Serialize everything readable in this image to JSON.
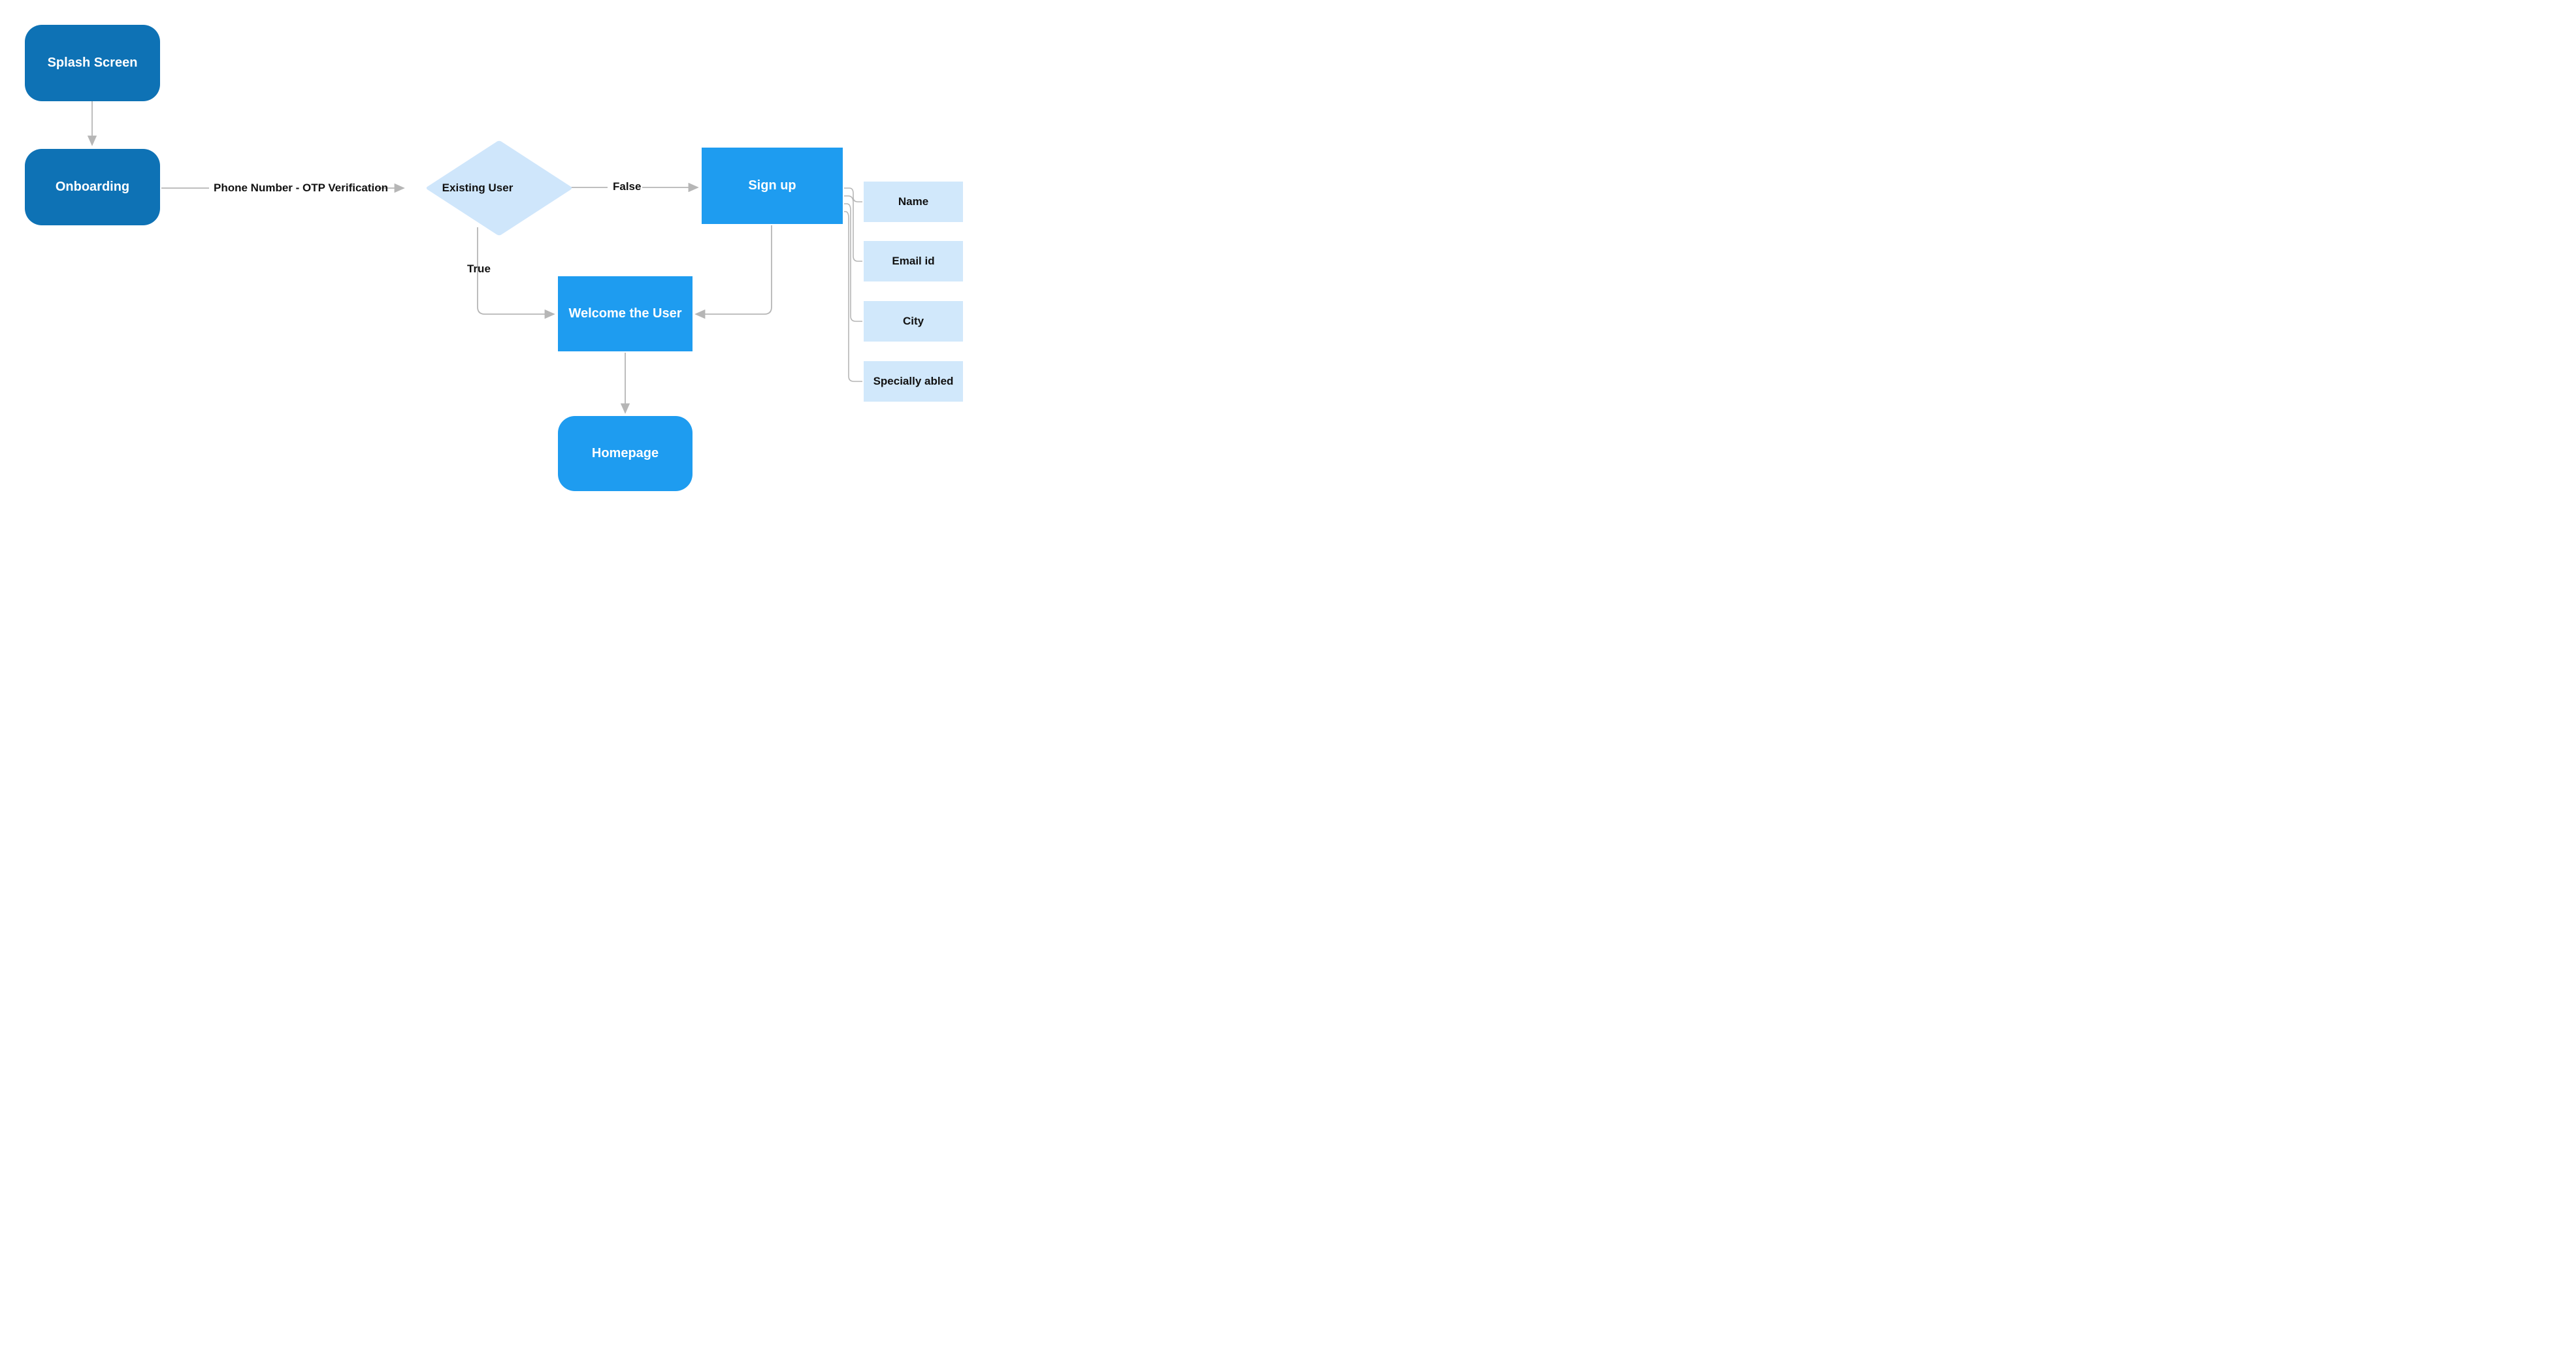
{
  "nodes": {
    "splash": "Splash Screen",
    "onboarding": "Onboarding",
    "existing_user": "Existing User",
    "signup": "Sign up",
    "welcome": "Welcome the User",
    "homepage": "Homepage"
  },
  "edges": {
    "onboarding_to_decision": "Phone Number - OTP  Verification",
    "decision_false": "False",
    "decision_true": "True"
  },
  "signup_fields": {
    "f1": "Name",
    "f2": "Email id",
    "f3": "City",
    "f4": "Specially abled"
  },
  "colors": {
    "deep_blue": "#0e72b5",
    "bright_blue": "#1e9cf0",
    "pale_blue": "#d1e8fb",
    "arrow": "#b6b6b6"
  }
}
